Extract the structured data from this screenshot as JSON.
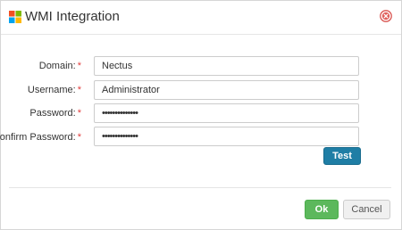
{
  "dialog": {
    "title": "WMI Integration",
    "close_icon": "close-circle-icon",
    "logo_icon": "windows-logo-icon"
  },
  "form": {
    "required_marker": "*",
    "fields": [
      {
        "label": "Domain:",
        "value": "Nectus",
        "type": "text"
      },
      {
        "label": "Username:",
        "value": "Administrator",
        "type": "text"
      },
      {
        "label": "Password:",
        "value": "••••••••••••••",
        "type": "password"
      },
      {
        "label": "Confirm Password:",
        "value": "••••••••••••••",
        "type": "password"
      }
    ],
    "test_label": "Test"
  },
  "footer": {
    "ok_label": "Ok",
    "cancel_label": "Cancel"
  },
  "colors": {
    "test_button": "#1f7ea5",
    "ok_button": "#5cb85c",
    "required": "#e23d3d",
    "close_icon": "#d9534f"
  }
}
